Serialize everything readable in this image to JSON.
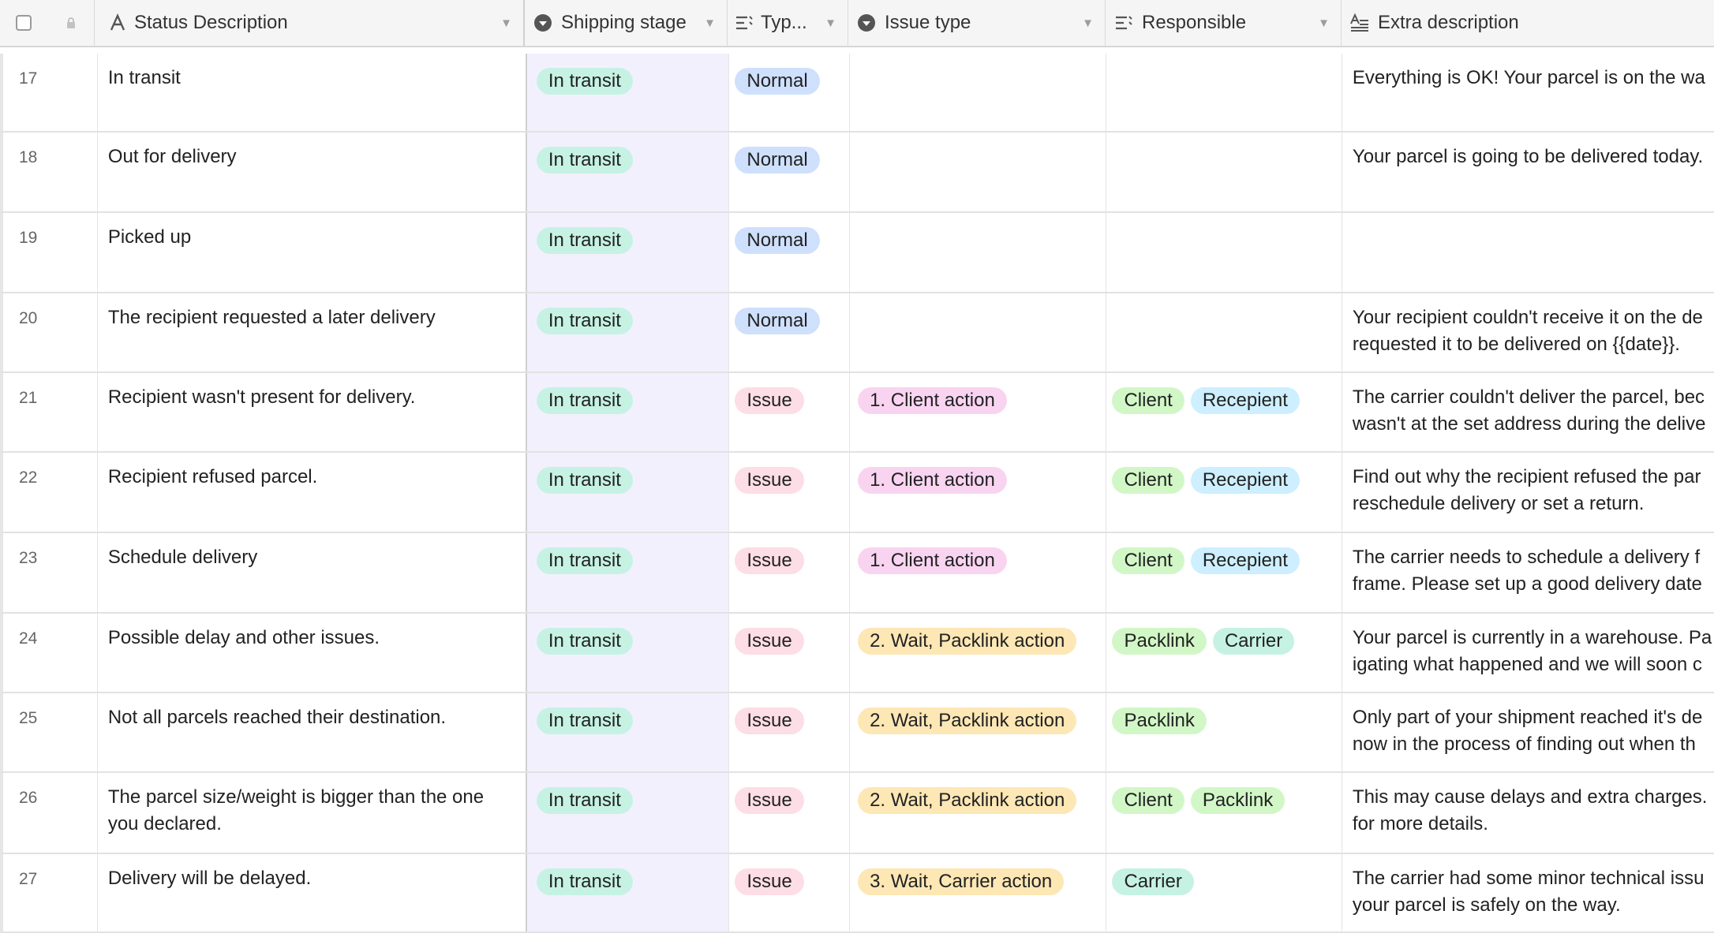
{
  "header": {
    "status_description": "Status Description",
    "shipping_stage": "Shipping stage",
    "type": "Typ...",
    "issue_type": "Issue type",
    "responsible": "Responsible",
    "extra_description": "Extra description"
  },
  "colors": {
    "in_transit": "#c6f2e4",
    "normal": "#cfe0fd",
    "issue": "#fddde6",
    "client_action": "#f9d4f0",
    "wait_action": "#fde7b5",
    "client": "#d2f7c7",
    "recepient": "#cdefff",
    "packlink": "#d2f7c7",
    "carrier": "#c6f2e4",
    "stage_column_bg": "#f3f0fd"
  },
  "rows": [
    {
      "num": "17",
      "desc": "In transit",
      "stage": "In transit",
      "type": "Normal",
      "issue": "",
      "responsible": [],
      "extra": [
        "Everything is OK! Your parcel is on the wa"
      ]
    },
    {
      "num": "18",
      "desc": "Out for delivery",
      "stage": "In transit",
      "type": "Normal",
      "issue": "",
      "responsible": [],
      "extra": [
        "Your parcel is going to be delivered today."
      ]
    },
    {
      "num": "19",
      "desc": "Picked up",
      "stage": "In transit",
      "type": "Normal",
      "issue": "",
      "responsible": [],
      "extra": []
    },
    {
      "num": "20",
      "desc": "The recipient requested a later delivery",
      "stage": "In transit",
      "type": "Normal",
      "issue": "",
      "responsible": [],
      "extra": [
        "Your recipient couldn't receive it on the de",
        "requested it to be delivered on {{date}}."
      ]
    },
    {
      "num": "21",
      "desc": "Recipient wasn't present for delivery.",
      "stage": "In transit",
      "type": "Issue",
      "issue": "1. Client action",
      "responsible": [
        "Client",
        "Recepient"
      ],
      "extra": [
        "The carrier couldn't deliver the parcel, bec",
        "wasn't at the set address during the delive"
      ]
    },
    {
      "num": "22",
      "desc": "Recipient refused parcel.",
      "stage": "In transit",
      "type": "Issue",
      "issue": "1. Client action",
      "responsible": [
        "Client",
        "Recepient"
      ],
      "extra": [
        "Find out why the recipient refused the par",
        "reschedule delivery or set a return."
      ]
    },
    {
      "num": "23",
      "desc": "Schedule delivery",
      "stage": "In transit",
      "type": "Issue",
      "issue": "1. Client action",
      "responsible": [
        "Client",
        "Recepient"
      ],
      "extra": [
        "The carrier needs to schedule a delivery f",
        "frame. Please set up a good delivery date"
      ]
    },
    {
      "num": "24",
      "desc": "Possible delay and other issues.",
      "stage": "In transit",
      "type": "Issue",
      "issue": "2. Wait, Packlink action",
      "responsible": [
        "Packlink",
        "Carrier"
      ],
      "extra": [
        "Your parcel is currently in a warehouse. Pa",
        "igating what happened and we will soon c"
      ]
    },
    {
      "num": "25",
      "desc": "Not all parcels reached their destination.",
      "stage": "In transit",
      "type": "Issue",
      "issue": "2. Wait, Packlink action",
      "responsible": [
        "Packlink"
      ],
      "extra": [
        "Only part of your shipment reached it's de",
        "now in the process of finding out when th"
      ]
    },
    {
      "num": "26",
      "desc": "The parcel size/weight is bigger than the one you declared.",
      "stage": "In transit",
      "type": "Issue",
      "issue": "2. Wait, Packlink action",
      "responsible": [
        "Client",
        "Packlink"
      ],
      "extra": [
        "This may cause delays and extra charges.",
        "for more details."
      ]
    },
    {
      "num": "27",
      "desc": "Delivery will be delayed.",
      "stage": "In transit",
      "type": "Issue",
      "issue": "3. Wait, Carrier action",
      "responsible": [
        "Carrier"
      ],
      "extra": [
        "The carrier had some minor technical issu",
        "your parcel is safely on the way."
      ]
    }
  ]
}
